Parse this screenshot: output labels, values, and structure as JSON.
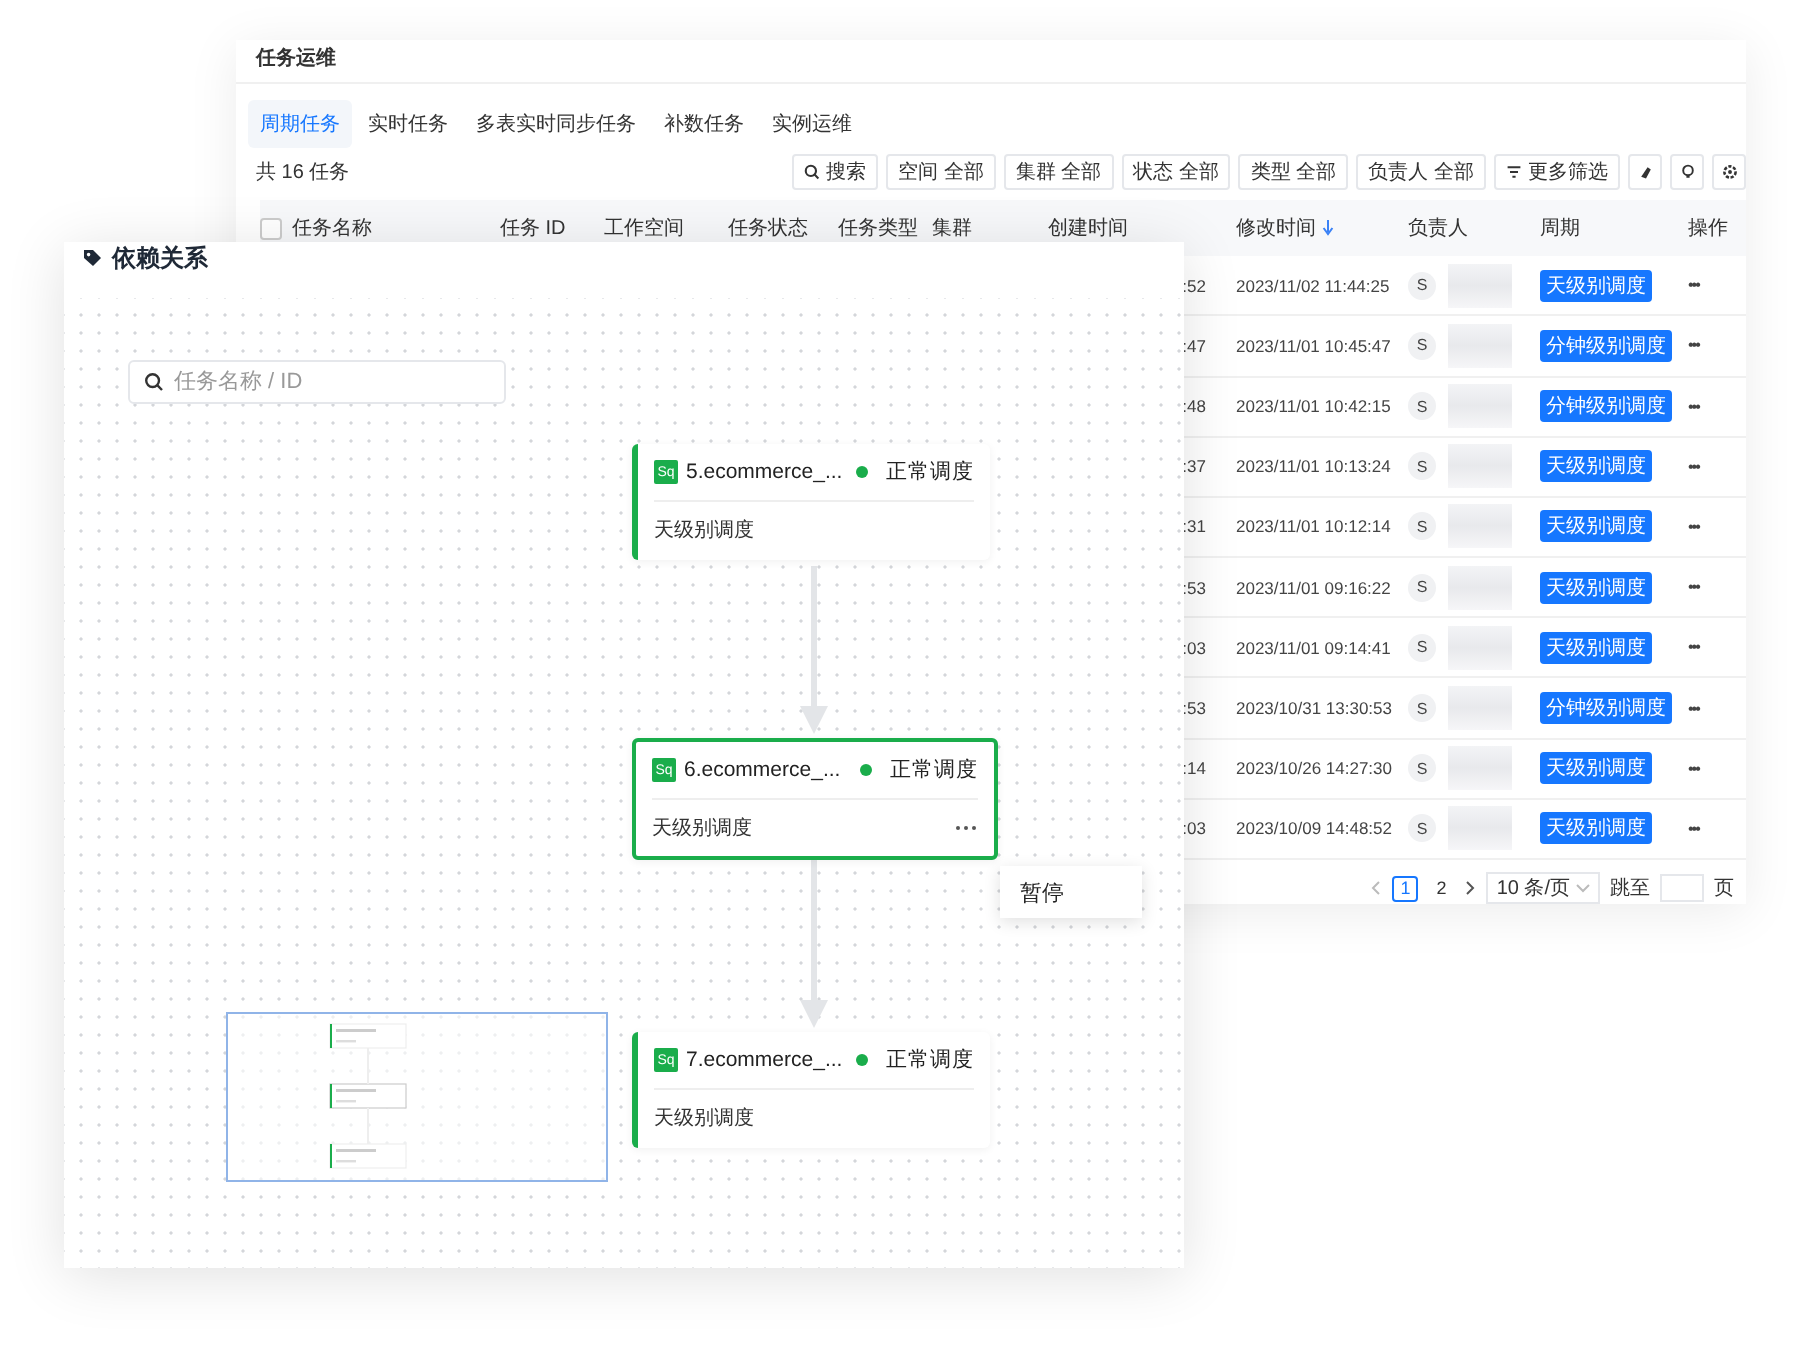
{
  "back_window": {
    "title": "任务运维",
    "tabs": [
      {
        "label": "周期任务",
        "selected": true
      },
      {
        "label": "实时任务",
        "selected": false
      },
      {
        "label": "多表实时同步任务",
        "selected": false
      },
      {
        "label": "补数任务",
        "selected": false
      },
      {
        "label": "实例运维",
        "selected": false
      }
    ],
    "count": "共 16 任务",
    "filters": [
      {
        "label": "搜索",
        "kind": "search"
      },
      {
        "label": "空间 全部",
        "kind": "select"
      },
      {
        "label": "集群 全部",
        "kind": "select"
      },
      {
        "label": "状态 全部",
        "kind": "select"
      },
      {
        "label": "类型 全部",
        "kind": "select"
      },
      {
        "label": "负责人 全部",
        "kind": "select"
      },
      {
        "label": "更多筛选",
        "kind": "more"
      }
    ],
    "table": {
      "select_all": {
        "checked": false
      },
      "columns": [
        {
          "label": "任务名称",
          "sorted": false
        },
        {
          "label": "任务 ID",
          "sorted": false
        },
        {
          "label": "工作空间",
          "sorted": false
        },
        {
          "label": "任务状态",
          "sorted": false
        },
        {
          "label": "任务类型",
          "sorted": false
        },
        {
          "label": "集群",
          "sorted": false
        },
        {
          "label": "创建时间",
          "sorted": false
        },
        {
          "label": "修改时间",
          "sorted": true
        },
        {
          "label": "负责人",
          "sorted": false
        },
        {
          "label": "周期",
          "sorted": false
        },
        {
          "label": "操作",
          "sorted": false
        }
      ],
      "rows": [
        {
          "created": ":52",
          "modified": "2023/11/02 11:44:25",
          "owner": "S",
          "period": "天级别调度",
          "action": "•••"
        },
        {
          "created": ":47",
          "modified": "2023/11/01 10:45:47",
          "owner": "S",
          "period": "分钟级别调度",
          "action": "•••"
        },
        {
          "created": ":48",
          "modified": "2023/11/01 10:42:15",
          "owner": "S",
          "period": "分钟级别调度",
          "action": "•••"
        },
        {
          "created": ":37",
          "modified": "2023/11/01 10:13:24",
          "owner": "S",
          "period": "天级别调度",
          "action": "•••"
        },
        {
          "created": ":31",
          "modified": "2023/11/01 10:12:14",
          "owner": "S",
          "period": "天级别调度",
          "action": "•••"
        },
        {
          "created": ":53",
          "modified": "2023/11/01 09:16:22",
          "owner": "S",
          "period": "天级别调度",
          "action": "•••"
        },
        {
          "created": ":03",
          "modified": "2023/11/01 09:14:41",
          "owner": "S",
          "period": "天级别调度",
          "action": "•••"
        },
        {
          "created": ":53",
          "modified": "2023/10/31 13:30:53",
          "owner": "S",
          "period": "分钟级别调度",
          "action": "•••"
        },
        {
          "created": ":14",
          "modified": "2023/10/26 14:27:30",
          "owner": "S",
          "period": "天级别调度",
          "action": "•••"
        },
        {
          "created": ":03",
          "modified": "2023/10/09 14:48:52",
          "owner": "S",
          "period": "天级别调度",
          "action": "•••"
        }
      ]
    },
    "pagination": {
      "pages": [
        {
          "label": "1",
          "selected": true
        },
        {
          "label": "2",
          "selected": false
        }
      ],
      "page_size": "10 条/页",
      "jump_label": "跳至",
      "page_unit": "页"
    }
  },
  "dependency_panel": {
    "title": "依赖关系",
    "search": {
      "placeholder": "任务名称 / ID"
    },
    "nodes": [
      {
        "badge": "Sq",
        "name": "5.ecommerce_...",
        "status": "正常调度",
        "schedule": "天级别调度",
        "selected": false
      },
      {
        "badge": "Sq",
        "name": "6.ecommerce_...",
        "status": "正常调度",
        "schedule": "天级别调度",
        "selected": true
      },
      {
        "badge": "Sq",
        "name": "7.ecommerce_...",
        "status": "正常调度",
        "schedule": "天级别调度",
        "selected": false
      }
    ],
    "menu": {
      "items": [
        "暂停"
      ]
    }
  }
}
